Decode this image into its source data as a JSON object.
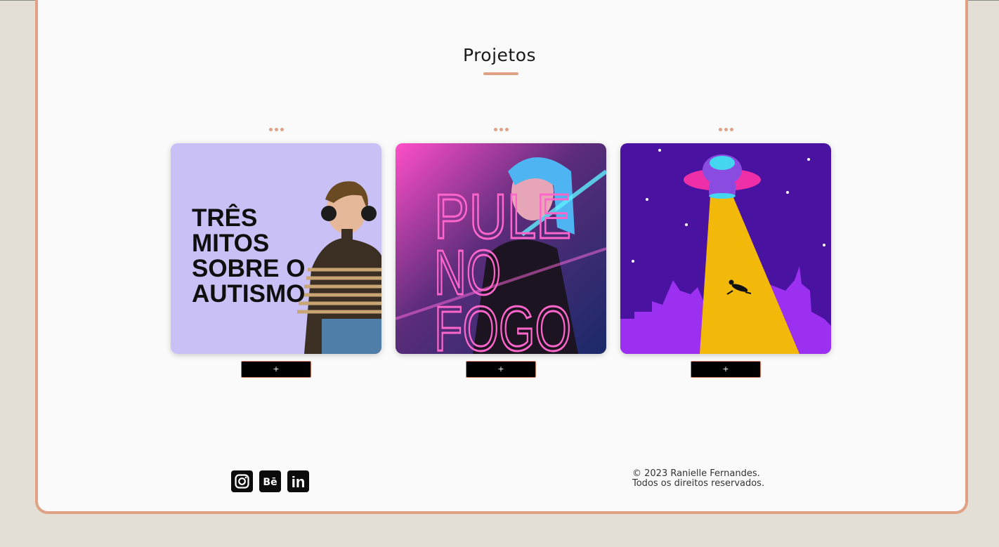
{
  "section": {
    "title": "Projetos"
  },
  "projects": [
    {
      "image_text": [
        "TRÊS",
        "MITOS",
        "SOBRE O",
        "AUTISMO"
      ],
      "more_label": "+",
      "colors": {
        "background": "#c9c0f5"
      }
    },
    {
      "image_text": [
        "PULE",
        "NO",
        "FOGO"
      ],
      "more_label": "+",
      "colors": {
        "background": "#7a3a8a"
      }
    },
    {
      "image_text": [],
      "more_label": "+",
      "colors": {
        "background": "#4a12a0",
        "beam": "#f2b90a"
      }
    }
  ],
  "footer": {
    "social": [
      {
        "icon": "instagram-icon"
      },
      {
        "icon": "behance-icon",
        "glyph": "Bē"
      },
      {
        "icon": "linkedin-icon",
        "glyph": "in"
      }
    ],
    "copyright_line1": "© 2023 Ranielle Fernandes.",
    "copyright_line2": "Todos os direitos reservados."
  },
  "colors": {
    "accent": "#e0a184",
    "page_background": "#e4dfd4",
    "panel_background": "#fafafa"
  }
}
